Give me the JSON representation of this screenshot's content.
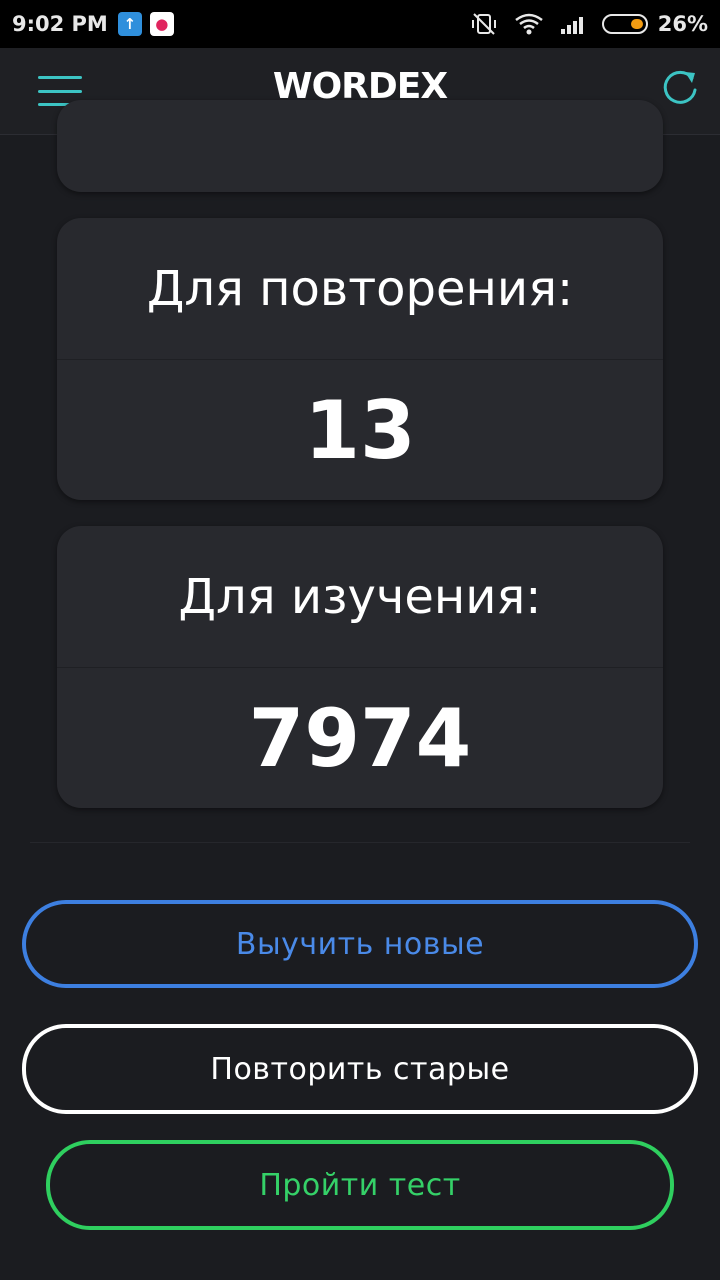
{
  "status_bar": {
    "time": "9:02 PM",
    "battery_percent": "26%",
    "battery_level": 0.26,
    "icons": [
      "upload-notification-icon",
      "app-notification-icon",
      "vibrate-off-icon",
      "wifi-icon",
      "signal-icon",
      "battery-icon"
    ]
  },
  "app_bar": {
    "title": "WORDEX",
    "menu_icon": "hamburger-menu-icon",
    "refresh_icon": "refresh-icon",
    "accent_color": "#3cc4c4"
  },
  "cards": {
    "review": {
      "label": "Для повторения:",
      "value": "13"
    },
    "learn": {
      "label": "Для изучения:",
      "value": "7974"
    }
  },
  "buttons": {
    "learn_new": {
      "label": "Выучить новые",
      "color": "#4a8ae8"
    },
    "repeat_old": {
      "label": "Повторить старые",
      "color": "#ffffff"
    },
    "take_test": {
      "label": "Пройти тест",
      "color": "#35d168"
    }
  }
}
